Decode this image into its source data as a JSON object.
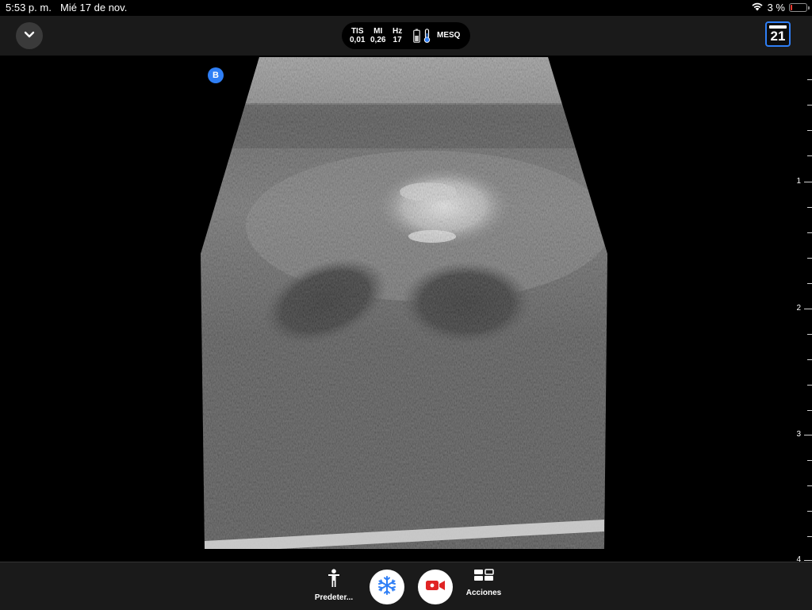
{
  "status_bar": {
    "time": "5:53 p. m.",
    "date": "Mié 17 de nov.",
    "battery_text": "3 %",
    "icons": [
      "wifi-icon",
      "battery-icon"
    ]
  },
  "top_bar": {
    "collapse_icon": "chevron-down-icon",
    "readout": {
      "tis_label": "TIS",
      "tis_value": "0,01",
      "mi_label": "MI",
      "mi_value": "0,26",
      "hz_label": "Hz",
      "hz_value": "17",
      "preset": "MESQ",
      "icons": [
        "battery-level-icon",
        "thermometer-icon"
      ]
    },
    "calendar_day": "21",
    "calendar_icon": "calendar-icon"
  },
  "image_area": {
    "mode_badge": "B",
    "depth_labels": [
      "1",
      "2",
      "3",
      "4"
    ]
  },
  "bottom_bar": {
    "preset_label": "Predeter...",
    "preset_icon": "person-icon",
    "freeze_icon": "snowflake-icon",
    "record_icon": "video-camera-icon",
    "actions_label": "Acciones",
    "actions_icon": "layout-grid-icon"
  },
  "colors": {
    "accent_blue": "#2f7ff6",
    "record_red": "#e02424",
    "bar_background": "#1a1a1a"
  }
}
